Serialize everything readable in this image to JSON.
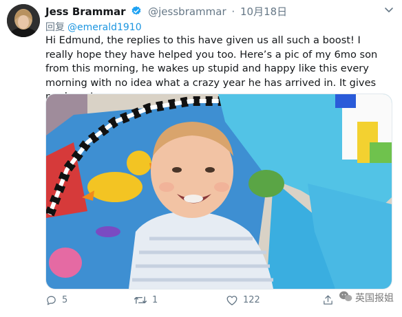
{
  "tweet": {
    "author_name": "Jess Brammar",
    "handle": "@jessbrammar",
    "separator": "·",
    "date": "10月18日",
    "reply_label": "回复",
    "reply_mention": "@emerald1910",
    "text": "Hi Edmund, the replies to this have given us all such a boost! I really hope they have helped you too. Here’s a pic of my 6mo son from this morning, he wakes up stupid and happy like this every morning with no idea what a crazy year he has arrived in. It gives me hope!"
  },
  "actions": {
    "reply_count": "5",
    "retweet_count": "1",
    "like_count": "122"
  },
  "watermark": {
    "text": "英国报姐"
  },
  "colors": {
    "link": "#1b95e0",
    "secondary": "#657786",
    "verified": "#1da1f2"
  },
  "icons": [
    "verified-badge-icon",
    "chevron-down-icon",
    "reply-icon",
    "retweet-icon",
    "like-icon",
    "share-icon"
  ]
}
